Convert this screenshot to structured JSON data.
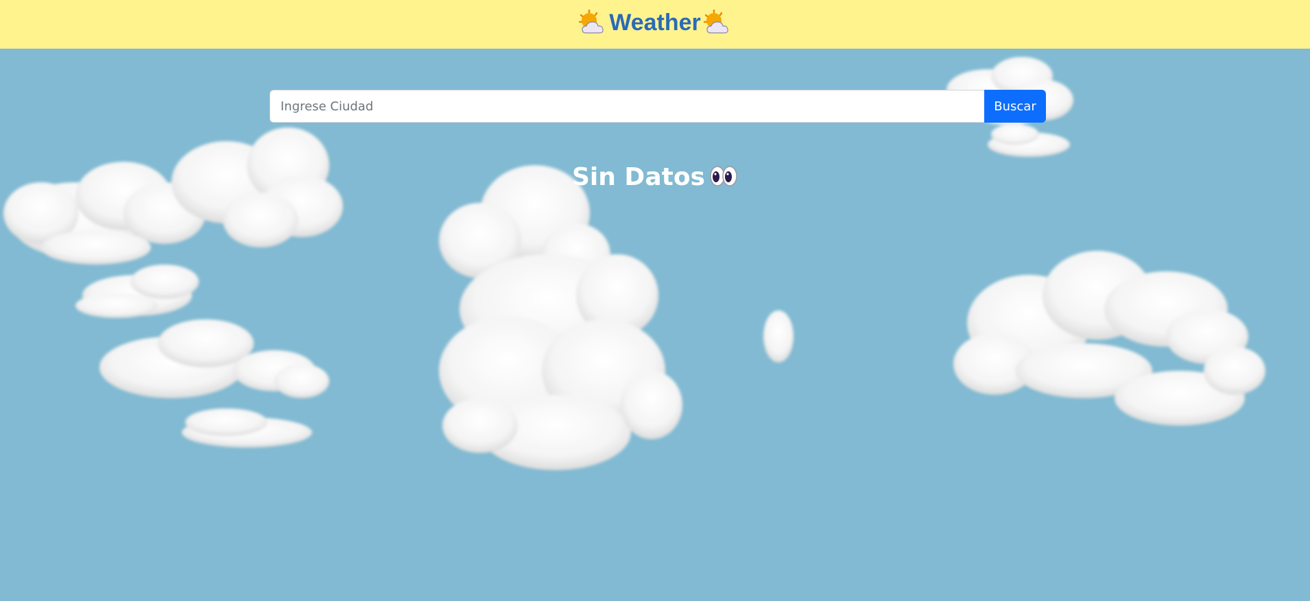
{
  "header": {
    "title": "Weather",
    "left_icon": "sun-behind-cloud-icon",
    "right_icon": "sun-behind-cloud-icon",
    "background": "#fff38e",
    "title_color": "#2a6ab8"
  },
  "search": {
    "placeholder": "Ingrese Ciudad",
    "value": "",
    "button_label": "Buscar",
    "button_color": "#0d6efd"
  },
  "status": {
    "text": "Sin Datos",
    "icon": "eyes-icon"
  },
  "colors": {
    "sky": "#81bad2"
  }
}
